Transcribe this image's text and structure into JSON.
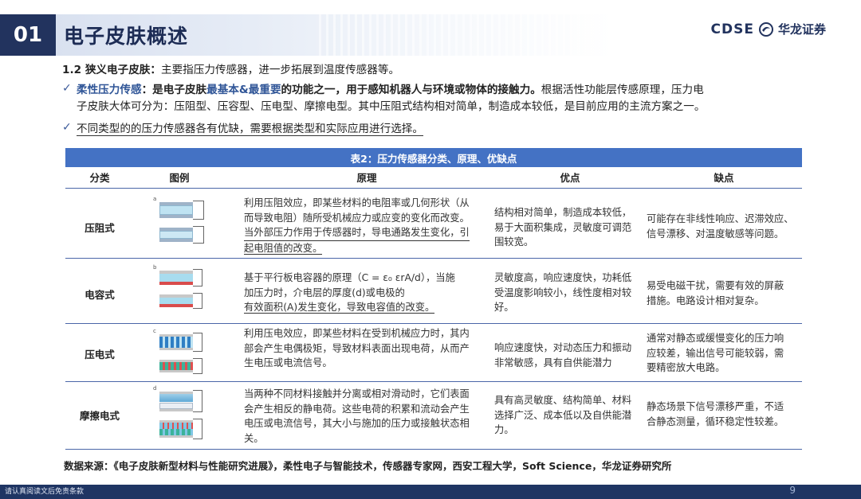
{
  "header": {
    "section_number": "01",
    "section_title": "电子皮肤概述",
    "logo_en": "CDSE",
    "logo_cn": "华龙证券"
  },
  "intro": {
    "heading_num": "1.2",
    "heading_label": "狭义电子皮肤：",
    "heading_text": "主要指压力传感器，进一步拓展到温度传感器等。",
    "bullet1_lead": "柔性压力传感",
    "bullet1_bold1": "：是电子皮肤",
    "bullet1_highlight": "最基本&最重要",
    "bullet1_bold2": "的功能之一，用于感知机器人与环境或物体的接触力。",
    "bullet1_rest1": "根据活性功能层传感原理，压力电",
    "bullet1_rest2": "子皮肤大体可分为：压阻型、压容型、压电型、摩擦电型。其中压阻式结构相对简单，制造成本较低，是目前应用的主流方案之一。",
    "bullet2": "不同类型的的压力传感器各有优缺，需要根据类型和实际应用进行选择。"
  },
  "table": {
    "title": "表2：压力传感器分类、原理、优缺点",
    "headers": [
      "分类",
      "图例",
      "原理",
      "优点",
      "缺点"
    ],
    "rows": [
      {
        "category": "压阻式",
        "principle": [
          "利用压阻效应，即某些材料的电阻率或几何形状（从",
          "而导致电阻）随所受机械应力或应变的变化而改变。",
          "当外部压力作用于传感器时，导电通路发生变化，引",
          "起电阻值的改变。"
        ],
        "pros": [
          "结构相对简单，制造成本较低，",
          "易于大面积集成，灵敏度可调范",
          "围较宽。"
        ],
        "cons": [
          "可能存在非线性响应、迟滞效应、",
          "信号漂移、对温度敏感等问题。"
        ]
      },
      {
        "category": "电容式",
        "principle": [
          "基于平行板电容器的原理（C = ε₀ εrA/d），当施",
          "加压力时，介电层的厚度(d)或电极的",
          "有效面积(A)发生变化，导致电容值的改变。"
        ],
        "pros": [
          "灵敏度高，响应速度快，功耗低",
          "受温度影响较小，线性度相对较",
          "好。"
        ],
        "cons": [
          "易受电磁干扰，需要有效的屏蔽",
          "措施。电路设计相对复杂。"
        ]
      },
      {
        "category": "压电式",
        "principle": [
          "利用压电效应，即某些材料在受到机械应力时，其内",
          "部会产生电偶极矩，导致材料表面出现电荷，从而产",
          "生电压或电流信号。"
        ],
        "pros": [
          "响应速度快，对动态压力和振动",
          "非常敏感，具有自供能潜力"
        ],
        "cons": [
          "通常对静态或缓慢变化的压力响",
          "应较差，输出信号可能较弱，需",
          "要精密放大电路。"
        ]
      },
      {
        "category": "摩擦电式",
        "principle": [
          "当两种不同材料接触并分离或相对滑动时，它们表面",
          "会产生相反的静电荷。这些电荷的积累和流动会产生",
          "电压或电流信号，其大小与施加的压力或接触状态相",
          "关。"
        ],
        "pros": [
          "具有高灵敏度、结构简单、材料",
          "选择广泛、成本低以及自供能潜",
          "力。"
        ],
        "cons": [
          "静态场景下信号漂移严重，不适",
          "合静态测量，循环稳定性较差。"
        ]
      }
    ],
    "figure_letters": [
      "a",
      "b",
      "c",
      "d"
    ]
  },
  "source": "数据来源：《电子皮肤新型材料与性能研究进展》，柔性电子与智能技术，传感器专家网，西安工程大学，Soft Science，华龙证券研究所",
  "footer": {
    "disclaimer": "请认真阅读文后免责条款",
    "page_number": "9"
  },
  "colors": {
    "navy": "#22335e",
    "table_title_bg": "#4472c4",
    "accent_blue": "#2f5597"
  }
}
